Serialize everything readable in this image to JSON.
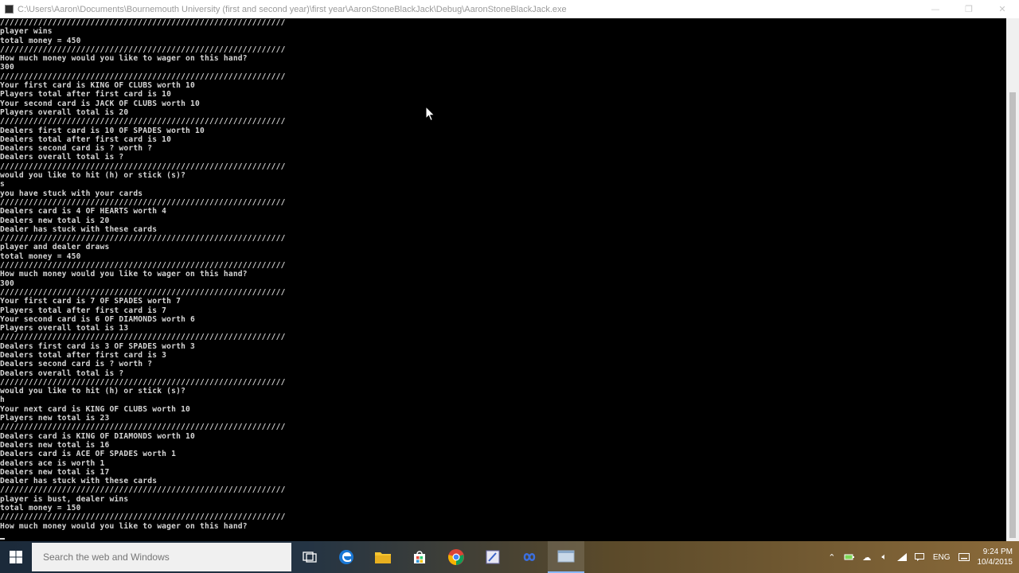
{
  "window": {
    "title": "C:\\Users\\Aaron\\Documents\\Bournemouth University (first and second year)\\first year\\AaronStoneBlackJack\\Debug\\AaronStoneBlackJack.exe",
    "minimize_glyph": "—",
    "maximize_glyph": "❐",
    "close_glyph": "✕"
  },
  "console": {
    "lines": [
      "////////////////////////////////////////////////////////////",
      "player wins",
      "total money = 450",
      "////////////////////////////////////////////////////////////",
      "How much money would you like to wager on this hand?",
      "300",
      "////////////////////////////////////////////////////////////",
      "Your first card is KING OF CLUBS worth 10",
      "Players total after first card is 10",
      "Your second card is JACK OF CLUBS worth 10",
      "Players overall total is 20",
      "////////////////////////////////////////////////////////////",
      "Dealers first card is 10 OF SPADES worth 10",
      "Dealers total after first card is 10",
      "Dealers second card is ? worth ?",
      "Dealers overall total is ?",
      "////////////////////////////////////////////////////////////",
      "would you like to hit (h) or stick (s)?",
      "s",
      "you have stuck with your cards",
      "////////////////////////////////////////////////////////////",
      "Dealers card is 4 OF HEARTS worth 4",
      "Dealers new total is 20",
      "Dealer has stuck with these cards",
      "////////////////////////////////////////////////////////////",
      "player and dealer draws",
      "total money = 450",
      "////////////////////////////////////////////////////////////",
      "How much money would you like to wager on this hand?",
      "300",
      "////////////////////////////////////////////////////////////",
      "Your first card is 7 OF SPADES worth 7",
      "Players total after first card is 7",
      "Your second card is 6 OF DIAMONDS worth 6",
      "Players overall total is 13",
      "////////////////////////////////////////////////////////////",
      "Dealers first card is 3 OF SPADES worth 3",
      "Dealers total after first card is 3",
      "Dealers second card is ? worth ?",
      "Dealers overall total is ?",
      "////////////////////////////////////////////////////////////",
      "would you like to hit (h) or stick (s)?",
      "h",
      "Your next card is KING OF CLUBS worth 10",
      "Players new total is 23",
      "////////////////////////////////////////////////////////////",
      "Dealers card is KING OF DIAMONDS worth 10",
      "Dealers new total is 16",
      "Dealers card is ACE OF SPADES worth 1",
      "dealers ace is worth 1",
      "Dealers new total is 17",
      "Dealer has stuck with these cards",
      "////////////////////////////////////////////////////////////",
      "player is bust, dealer wins",
      "total money = 150",
      "////////////////////////////////////////////////////////////",
      "How much money would you like to wager on this hand?"
    ]
  },
  "taskbar": {
    "search_placeholder": "Search the web and Windows",
    "tray_lang": "ENG",
    "time": "9:24 PM",
    "date": "10/4/2015"
  },
  "colors": {
    "console_bg": "#000000",
    "console_text": "#d6d6d6",
    "titlebar_bg": "#ffffff"
  }
}
